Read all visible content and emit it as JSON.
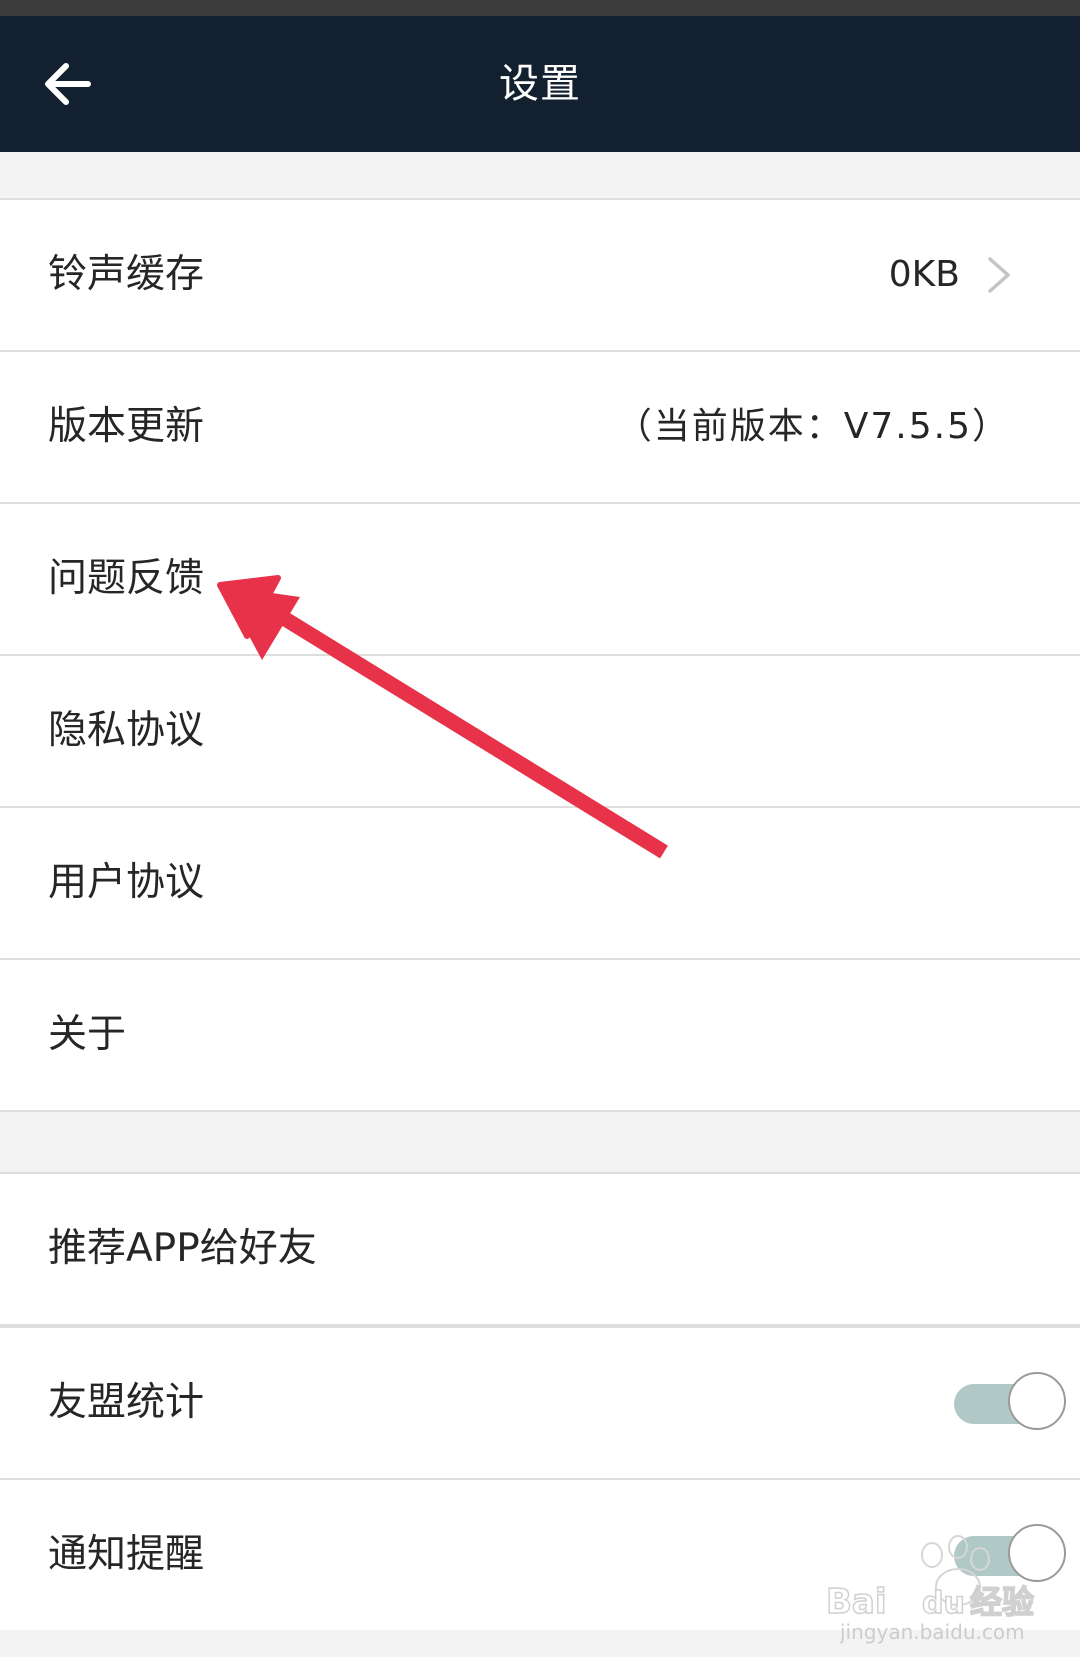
{
  "header": {
    "title": "设置"
  },
  "group1": {
    "items": [
      {
        "label": "铃声缓存",
        "value": "0KB"
      },
      {
        "label": "版本更新",
        "value": "（当前版本：V7.5.5）"
      },
      {
        "label": "问题反馈"
      },
      {
        "label": "隐私协议"
      },
      {
        "label": "用户协议"
      },
      {
        "label": "关于"
      }
    ]
  },
  "group2": {
    "items": [
      {
        "label": "推荐APP给好友"
      }
    ]
  },
  "group3": {
    "items": [
      {
        "label": "友盟统计",
        "toggle_on": true
      },
      {
        "label": "通知提醒",
        "toggle_on": true
      }
    ]
  },
  "colors": {
    "header_bg": "#13202f",
    "annotation_arrow": "#e83249",
    "toggle_track": "#b0c8c6"
  },
  "icons": {
    "back": "back-arrow-icon",
    "chevron": "chevron-right-icon"
  },
  "watermark": {
    "text": "Bai du 经验",
    "url_text": "jingyan.baidu.com"
  }
}
